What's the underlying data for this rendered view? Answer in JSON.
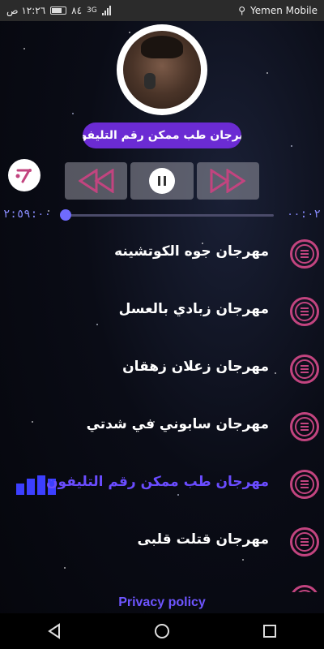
{
  "status_bar": {
    "time": "١٢:٢٦ ص",
    "battery_text": "٨٤",
    "network_type": "3G",
    "carrier": "Yemen Mobile"
  },
  "player": {
    "now_playing": "مهرجان طب ممكن رقم التليفون",
    "elapsed": "٠٠:٠٢",
    "total": "٢:٥٩:٠٠",
    "progress": 0.0
  },
  "songs": [
    {
      "title": "مهرجان جوه الكوتشينه",
      "active": false
    },
    {
      "title": "مهرجان زبادي بالعسل",
      "active": false
    },
    {
      "title": "مهرجان زعلان زهقان",
      "active": false
    },
    {
      "title": "مهرجان سابوني في شدتي",
      "active": false
    },
    {
      "title": "مهرجان طب ممكن رقم التليفون",
      "active": true
    },
    {
      "title": "مهرجان قتلت قلبى",
      "active": false
    }
  ],
  "footer": {
    "privacy_label": "Privacy policy"
  },
  "colors": {
    "accent_purple": "#6b2bd3",
    "active_text": "#6a4cff",
    "menu_pink": "#c2447f",
    "eq_blue": "#3c3fff"
  }
}
